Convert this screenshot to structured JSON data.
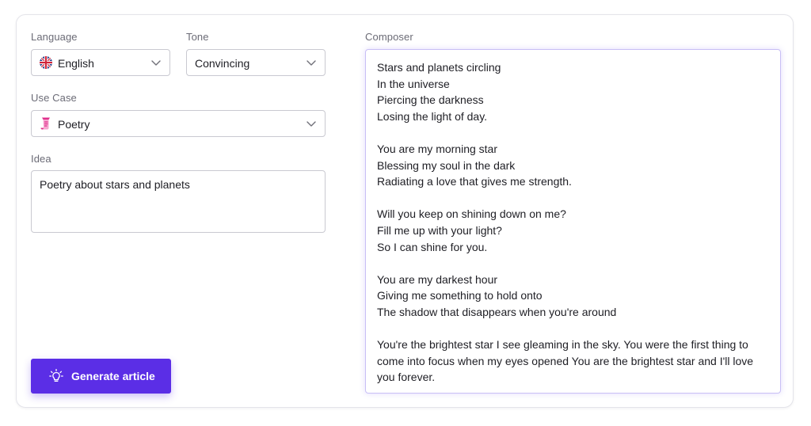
{
  "language": {
    "label": "Language",
    "value": "English",
    "flag_icon": "uk-flag-icon"
  },
  "tone": {
    "label": "Tone",
    "value": "Convincing"
  },
  "use_case": {
    "label": "Use Case",
    "value": "Poetry",
    "icon": "poetry-scroll-icon"
  },
  "idea": {
    "label": "Idea",
    "value": "Poetry about stars and planets"
  },
  "generate_button": {
    "label": "Generate article",
    "icon": "lightbulb-icon"
  },
  "composer": {
    "label": "Composer",
    "stanzas": [
      [
        "Stars and planets circling",
        "In the universe",
        "Piercing the darkness",
        "Losing the light of day."
      ],
      [
        "You are my morning star",
        "Blessing my soul in the dark",
        "Radiating a love that gives me strength."
      ],
      [
        "Will you keep on shining down on me?",
        "Fill me up with your light?",
        "So I can shine for you."
      ],
      [
        "You are my darkest hour",
        "Giving me something to hold onto",
        "The shadow that disappears when you're around"
      ],
      [
        "You're the brightest star I see gleaming in the sky. You were the first thing to",
        "come into focus when my eyes opened You are the brightest star and I'll love",
        "you forever."
      ]
    ]
  },
  "colors": {
    "accent": "#5b2ee6",
    "composer_border": "#c8bff5",
    "label_text": "#6b6b76"
  }
}
